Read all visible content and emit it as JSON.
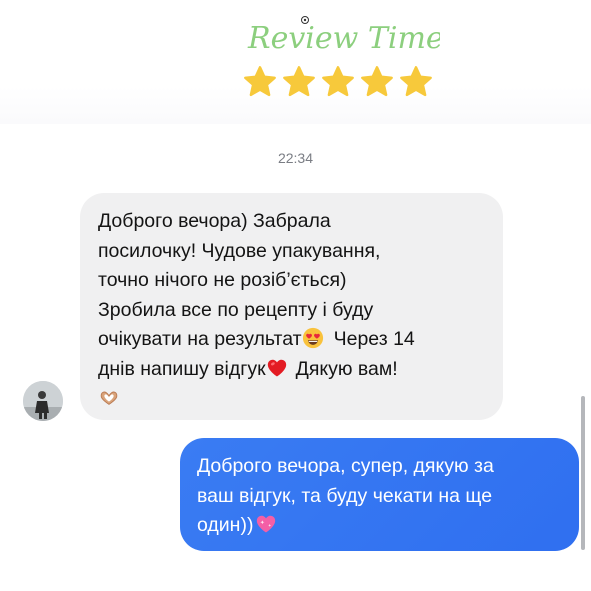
{
  "brand": {
    "logo_text": "Review Time",
    "accent_color": "#8ccf7e",
    "star_color": "#f7c93b",
    "rating": 5
  },
  "chat": {
    "timestamp": "22:34",
    "incoming": {
      "lines": [
        "Доброго вечора) Забрала",
        "посилочку! Чудове упакування,",
        "точно нічого не розіб’ється)",
        "Зробила все по рецепту і буду",
        "очікувати на результат",
        "Через 14",
        "днів напишу відгук",
        "Дякую вам!"
      ],
      "emojis": [
        "heart-eyes-emoji",
        "red-heart-emoji",
        "heart-hands-emoji"
      ],
      "bubble_color": "#f0f0f1"
    },
    "outgoing": {
      "lines": [
        "Доброго вечора, супер, дякую за",
        "ваш відгук, та буду чекати на ще",
        "один))"
      ],
      "emojis": [
        "sparkling-heart-emoji"
      ],
      "bubble_color": "#3a7cf3"
    }
  }
}
